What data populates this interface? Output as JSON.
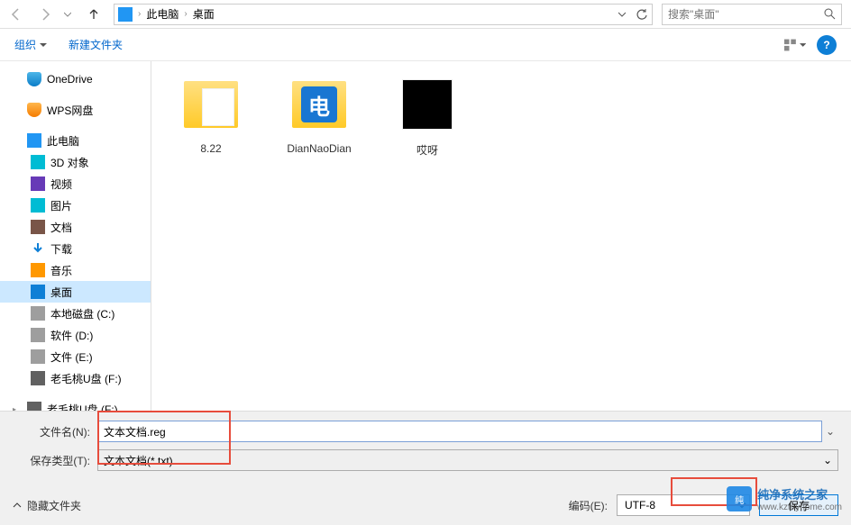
{
  "nav": {
    "breadcrumb": [
      "此电脑",
      "桌面"
    ],
    "search_placeholder": "搜索\"桌面\""
  },
  "toolbar": {
    "organize": "组织",
    "new_folder": "新建文件夹"
  },
  "sidebar": {
    "onedrive": "OneDrive",
    "wps": "WPS网盘",
    "this_pc": "此电脑",
    "items": [
      {
        "label": "3D 对象",
        "icon": "icon-3d"
      },
      {
        "label": "视频",
        "icon": "icon-video"
      },
      {
        "label": "图片",
        "icon": "icon-pictures"
      },
      {
        "label": "文档",
        "icon": "icon-docs"
      },
      {
        "label": "下载",
        "icon": "icon-downloads"
      },
      {
        "label": "音乐",
        "icon": "icon-music"
      },
      {
        "label": "桌面",
        "icon": "icon-desktop",
        "selected": true
      },
      {
        "label": "本地磁盘 (C:)",
        "icon": "icon-drive"
      },
      {
        "label": "软件 (D:)",
        "icon": "icon-drive"
      },
      {
        "label": "文件 (E:)",
        "icon": "icon-drive"
      },
      {
        "label": "老毛桃U盘 (F:)",
        "icon": "icon-usb"
      }
    ],
    "usb_root": "老毛桃U盘 (F:)"
  },
  "files": [
    {
      "name": "8.22",
      "type": "folder-docs"
    },
    {
      "name": "DianNaoDian",
      "type": "folder-app"
    },
    {
      "name": "哎呀",
      "type": "thumb-black"
    }
  ],
  "bottom": {
    "filename_label": "文件名(N):",
    "filename_value": "文本文档.reg",
    "filetype_label": "保存类型(T):",
    "filetype_value": "文本文档(*.txt)",
    "hide_folders": "隐藏文件夹",
    "encoding_label": "编码(E):",
    "encoding_value": "UTF-8",
    "save": "保存"
  },
  "watermark": {
    "title": "纯净系统之家",
    "url": "www.kzmyhome.com"
  }
}
